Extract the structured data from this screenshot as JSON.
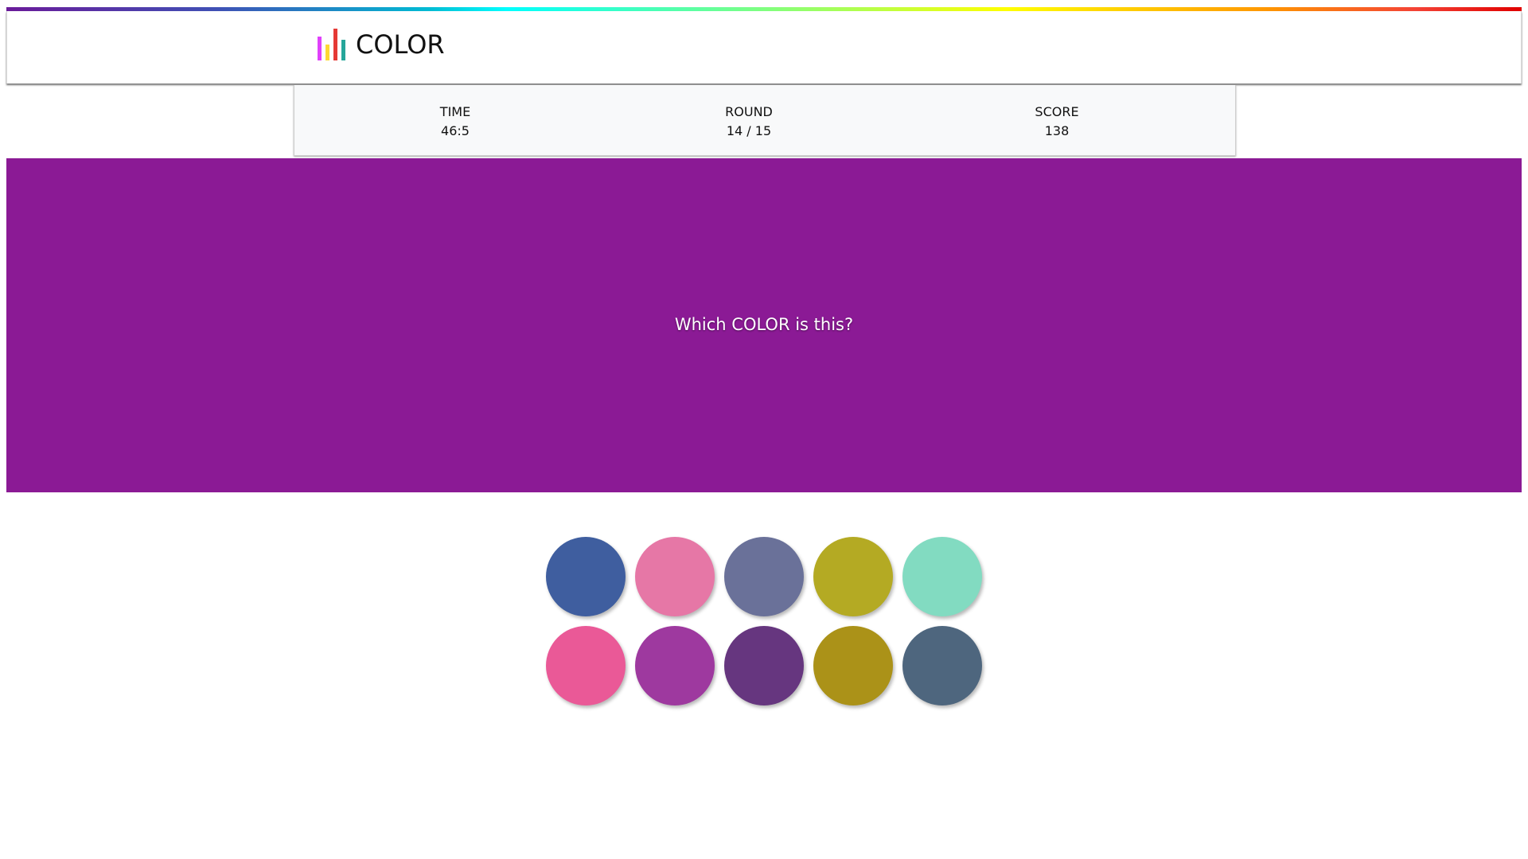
{
  "logo": {
    "text": "COLOR",
    "bars": [
      "#e040fb",
      "#fdd835",
      "#e53935",
      "#26a69a"
    ]
  },
  "stats": {
    "time_label": "TIME",
    "time_value": "46:5",
    "round_label": "ROUND",
    "round_value": "14 / 15",
    "score_label": "SCORE",
    "score_value": "138"
  },
  "stage": {
    "background": "#8b1a95",
    "prompt": "Which COLOR is this?"
  },
  "swatches": [
    {
      "color": "#3f5e9f"
    },
    {
      "color": "#e677a6"
    },
    {
      "color": "#6a7199"
    },
    {
      "color": "#b4aa23"
    },
    {
      "color": "#82dbc1"
    },
    {
      "color": "#ea5997"
    },
    {
      "color": "#9e399f"
    },
    {
      "color": "#66367f"
    },
    {
      "color": "#ab9218"
    },
    {
      "color": "#4e667e"
    }
  ]
}
